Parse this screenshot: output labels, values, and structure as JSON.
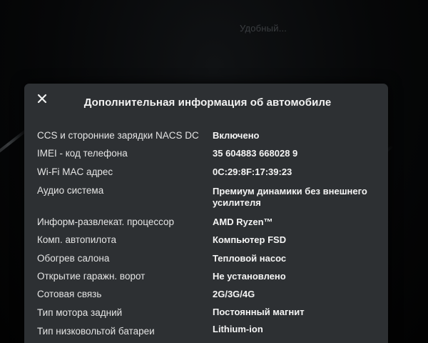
{
  "background": {
    "hint_text": "Удобный..."
  },
  "dialog": {
    "title": "Дополнительная информация об автомобиле",
    "close_icon": "close-icon",
    "rows": [
      {
        "label": "CCS и сторонние зарядки NACS DC",
        "value": "Включено"
      },
      {
        "label": "IMEI - код телефона",
        "value": "35 604883 668028 9"
      },
      {
        "label": "Wi-Fi MAC адрес",
        "value": "0C:29:8F:17:39:23"
      },
      {
        "label": "Аудио система",
        "value": "Премиум динамики без внешнего усилителя"
      },
      {
        "label": "Информ-развлекат. процессор",
        "value": "AMD Ryzen™"
      },
      {
        "label": "Комп. автопилота",
        "value": "Компьютер FSD"
      },
      {
        "label": "Обогрев салона",
        "value": "Тепловой насос"
      },
      {
        "label": "Открытие гаражн. ворот",
        "value": "Не установлено"
      },
      {
        "label": "Сотовая связь",
        "value": "2G/3G/4G"
      },
      {
        "label": "Тип мотора задний",
        "value": "Постоянный магнит"
      },
      {
        "label": "Тип низковольтой батареи",
        "value": "Lithium-ion"
      }
    ]
  },
  "colors": {
    "dialog_background": "#2d3033",
    "screen_background": "#050505",
    "text_primary": "#f4f4f4"
  }
}
